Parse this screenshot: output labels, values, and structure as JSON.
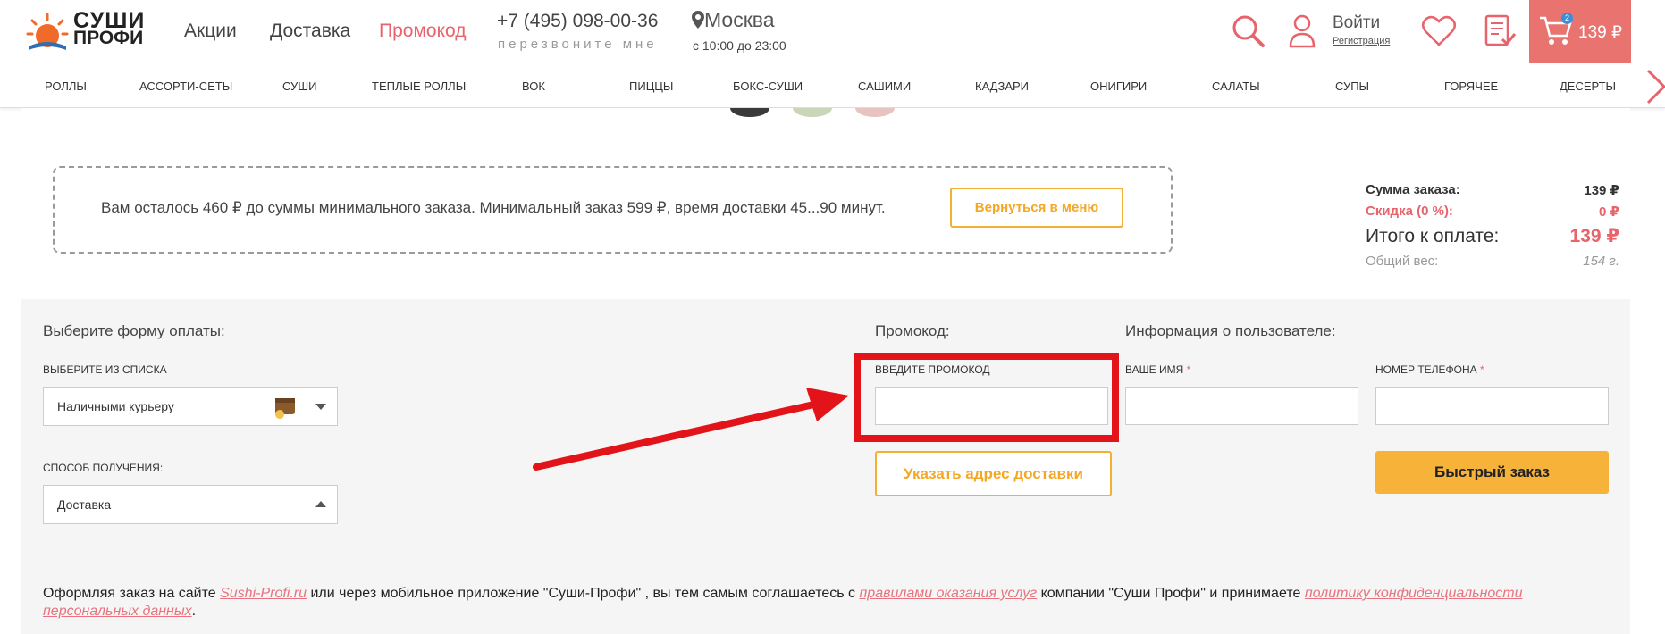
{
  "header": {
    "logo_line1": "СУШИ",
    "logo_line2": "ПРОФИ",
    "nav": {
      "promotions": "Акции",
      "delivery": "Доставка",
      "promocode": "Промокод"
    },
    "phone": "+7 (495) 098-00-36",
    "callback": "перезвоните мне",
    "city": "Москва",
    "hours": "с 10:00 до 23:00",
    "login": "Войти",
    "register": "Регистрация",
    "cart_count": "2",
    "cart_total": "139 ₽"
  },
  "categories": [
    "Роллы",
    "Ассорти-сеты",
    "Суши",
    "Теплые роллы",
    "Вок",
    "Пиццы",
    "Бокс-суши",
    "Сашими",
    "Кадзари",
    "Онигири",
    "Салаты",
    "Супы",
    "Горячее",
    "Десерты"
  ],
  "notice": {
    "text": "Вам осталось 460 ₽ до суммы минимального заказа. Минимальный заказ 599 ₽, время доставки 45...90 минут.",
    "back_button": "Вернуться в меню"
  },
  "summary": {
    "order_sum_label": "Сумма заказа:",
    "order_sum_value": "139 ₽",
    "discount_label": "Скидка (0 %):",
    "discount_value": "0 ₽",
    "total_label": "Итого к оплате:",
    "total_value": "139 ₽",
    "weight_label": "Общий вес:",
    "weight_value": "154 г."
  },
  "payment": {
    "title": "Выберите форму оплаты:",
    "list_label": "Выберите из списка",
    "payment_value": "Наличными курьеру",
    "method_label": "Способ получения:",
    "method_value": "Доставка"
  },
  "promo": {
    "title": "Промокод:",
    "input_label": "Введите промокод",
    "input_value": "",
    "address_button": "Указать адрес доставки"
  },
  "user": {
    "title": "Информация о пользователе:",
    "name_label": "Ваше имя",
    "phone_label": "Номер телефона",
    "required_mark": "*",
    "name_value": "",
    "phone_value": "",
    "fast_order_button": "Быстрый заказ"
  },
  "legal": {
    "part1": "Оформляя заказ на сайте ",
    "link_site": "Sushi-Profi.ru",
    "part2": " или через мобильное приложение \"Суши-Профи\" , вы тем самым соглашаетесь с ",
    "link_rules": "правилами оказания услуг",
    "part3": " компании \"Суши Профи\" и принимаете ",
    "link_policy": "политику конфиденциальности персональных данных",
    "part4": "."
  },
  "colors": {
    "accent": "#e8646c",
    "orange": "#f7b23a",
    "cart_bg": "#e8736f",
    "highlight": "#e2141a"
  }
}
